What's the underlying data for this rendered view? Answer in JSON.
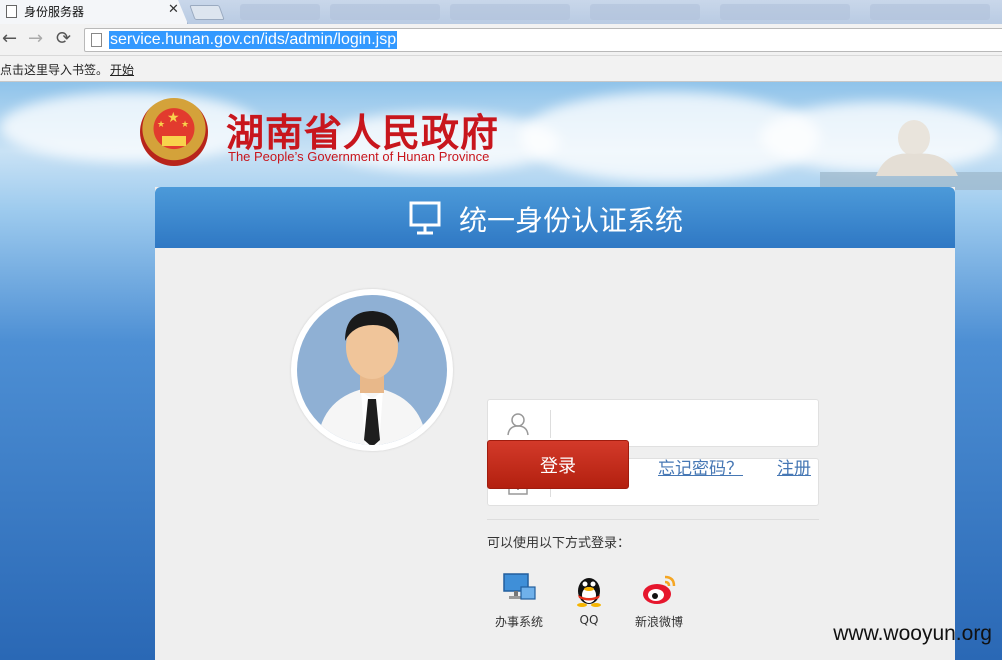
{
  "browser": {
    "tab_title": "身份服务器",
    "url": "service.hunan.gov.cn/ids/admin/login.jsp",
    "bookmarks_hint": "点击这里导入书签。",
    "bookmarks_start": "开始"
  },
  "header": {
    "title_cn": "湖南省人民政府",
    "title_en": "The People’s Government of Hunan Province"
  },
  "panel": {
    "title": "统一身份认证系统"
  },
  "form": {
    "username_placeholder": "",
    "password_placeholder": "",
    "login_label": "登录",
    "forgot_label": "忘记密码？",
    "register_label": "注册"
  },
  "alt_login": {
    "label": "可以使用以下方式登录：",
    "options": [
      {
        "label": "办事系统",
        "icon": "computer-icon"
      },
      {
        "label": "QQ",
        "icon": "qq-penguin-icon"
      },
      {
        "label": "新浪微博",
        "icon": "weibo-icon"
      }
    ]
  },
  "watermark": "www.wooyun.org",
  "colors": {
    "brand_red": "#c8161d",
    "panel_blue": "#2f78c4",
    "link_blue": "#4677b4"
  }
}
